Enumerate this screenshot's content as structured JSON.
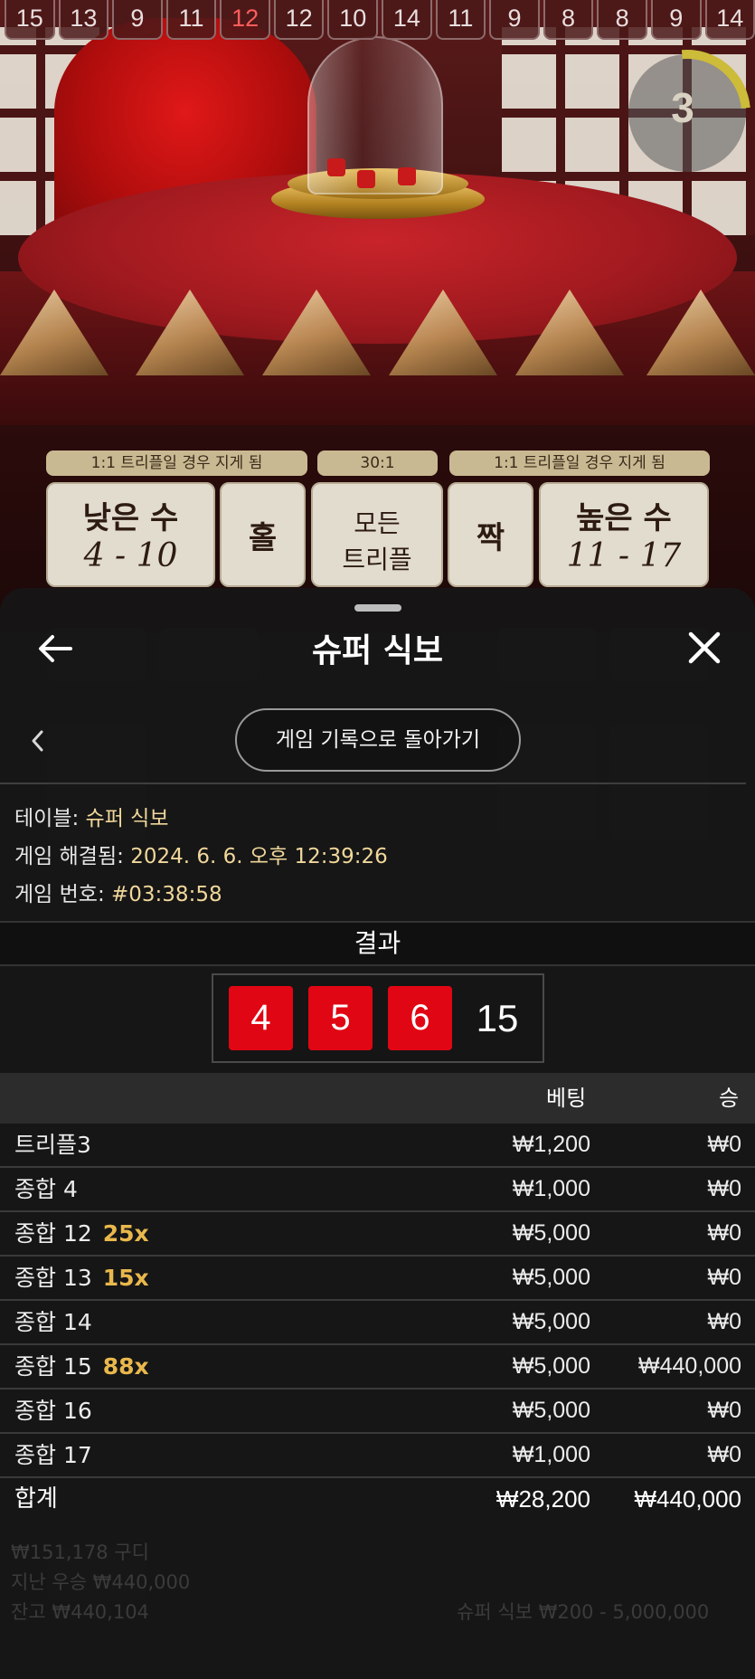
{
  "history": [
    "15",
    "13",
    "9",
    "11",
    "12",
    "12",
    "10",
    "14",
    "11",
    "9",
    "8",
    "8",
    "9",
    "14"
  ],
  "timer": "3",
  "bet_labels": {
    "left": "1:1 트리플일 경우 지게 됨",
    "center": "30:1",
    "right": "1:1 트리플일 경우 지게 됨"
  },
  "bet_buttons": {
    "low": {
      "title": "낮은 수",
      "range": "4 - 10"
    },
    "odd": "홀",
    "any_triple": {
      "line1": "모든",
      "line2": "트리플"
    },
    "even": "짝",
    "high": {
      "title": "높은 수",
      "range": "11 - 17"
    }
  },
  "panel": {
    "title": "슈퍼 식보",
    "back_to_history": "게임 기록으로 돌아가기",
    "table_label": "테이블:",
    "table_value": "슈퍼 식보",
    "resolved_label": "게임 해결됨:",
    "resolved_value": "2024. 6. 6. 오후 12:39:26",
    "game_no_label": "게임 번호:",
    "game_no_value": "#03:38:58",
    "result_label": "결과",
    "dice": [
      "4",
      "5",
      "6"
    ],
    "sum": "15",
    "col_bet": "베팅",
    "col_win": "승",
    "rows": [
      {
        "name": "트리플3",
        "mult": "",
        "bet": "₩1,200",
        "win": "₩0"
      },
      {
        "name": "종합 4",
        "mult": "",
        "bet": "₩1,000",
        "win": "₩0"
      },
      {
        "name": "종합 12",
        "mult": "25x",
        "bet": "₩5,000",
        "win": "₩0"
      },
      {
        "name": "종합 13",
        "mult": "15x",
        "bet": "₩5,000",
        "win": "₩0"
      },
      {
        "name": "종합 14",
        "mult": "",
        "bet": "₩5,000",
        "win": "₩0"
      },
      {
        "name": "종합 15",
        "mult": "88x",
        "bet": "₩5,000",
        "win": "₩440,000"
      },
      {
        "name": "종합 16",
        "mult": "",
        "bet": "₩5,000",
        "win": "₩0"
      },
      {
        "name": "종합 17",
        "mult": "",
        "bet": "₩1,000",
        "win": "₩0"
      }
    ],
    "total": {
      "name": "합계",
      "bet": "₩28,200",
      "win": "₩440,000"
    }
  },
  "footer": {
    "balance": "₩151,178 구디",
    "last_win": "지난 우승 ₩440,000",
    "cash": "잔고 ₩440,104",
    "limits": "슈퍼 식보 ₩200 - 5,000,000"
  },
  "colors": {
    "die_red": "#e10613",
    "multiplier": "#e9b84c",
    "info_value": "#f0d79b"
  }
}
